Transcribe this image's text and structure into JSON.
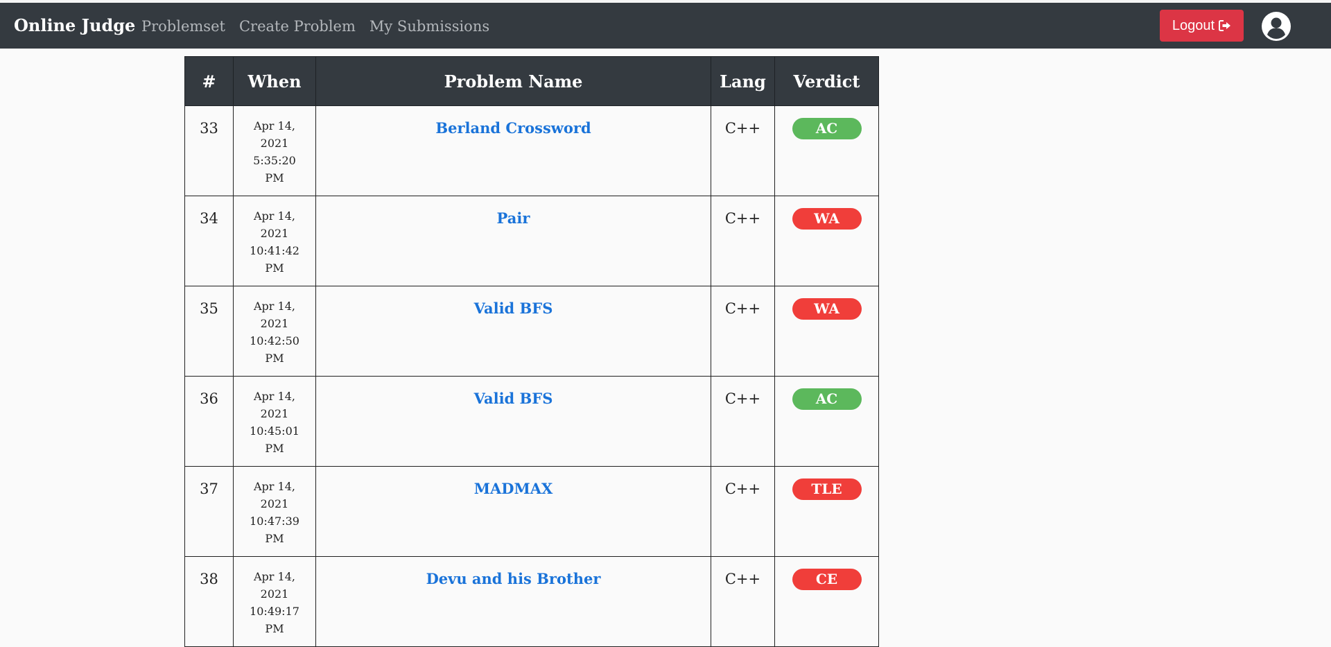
{
  "navbar": {
    "brand": "Online Judge",
    "links": [
      "Problemset",
      "Create Problem",
      "My Submissions"
    ],
    "logout_label": "Logout",
    "logout_icon": "sign-out-icon",
    "avatar_icon": "user-circle-icon"
  },
  "table": {
    "headers": [
      "#",
      "When",
      "Problem Name",
      "Lang",
      "Verdict"
    ],
    "rows": [
      {
        "id": "33",
        "when": [
          "Apr 14,",
          "2021",
          "5:35:20",
          "PM"
        ],
        "problem": "Berland Crossword",
        "lang": "C++",
        "verdict": "AC"
      },
      {
        "id": "34",
        "when": [
          "Apr 14,",
          "2021",
          "10:41:42",
          "PM"
        ],
        "problem": "Pair",
        "lang": "C++",
        "verdict": "WA"
      },
      {
        "id": "35",
        "when": [
          "Apr 14,",
          "2021",
          "10:42:50",
          "PM"
        ],
        "problem": "Valid BFS",
        "lang": "C++",
        "verdict": "WA"
      },
      {
        "id": "36",
        "when": [
          "Apr 14,",
          "2021",
          "10:45:01",
          "PM"
        ],
        "problem": "Valid BFS",
        "lang": "C++",
        "verdict": "AC"
      },
      {
        "id": "37",
        "when": [
          "Apr 14,",
          "2021",
          "10:47:39",
          "PM"
        ],
        "problem": "MADMAX",
        "lang": "C++",
        "verdict": "TLE"
      },
      {
        "id": "38",
        "when": [
          "Apr 14,",
          "2021",
          "10:49:17",
          "PM"
        ],
        "problem": "Devu and his Brother",
        "lang": "C++",
        "verdict": "CE"
      }
    ]
  },
  "colors": {
    "navbar_bg": "#343a40",
    "accepted": "#5cb85c",
    "rejected": "#f03e3a",
    "link": "#1a73d9",
    "logout": "#dc3545"
  }
}
